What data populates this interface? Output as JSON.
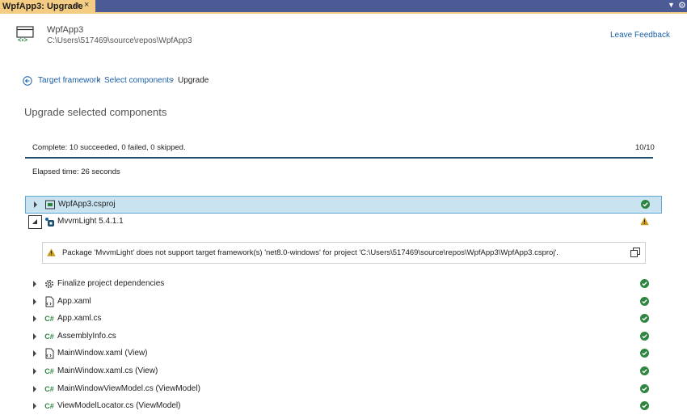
{
  "tab": {
    "title": "WpfApp3: Upgrade",
    "pin_glyph": "⊕",
    "close_glyph": "×",
    "dropdown_glyph": "▼",
    "gear_glyph": "⚙"
  },
  "header": {
    "project_name": "WpfApp3",
    "project_path": "C:\\Users\\517469\\source\\repos\\WpfApp3",
    "feedback_label": "Leave Feedback"
  },
  "breadcrumb": {
    "items": [
      "Target framework",
      "Select components",
      "Upgrade"
    ],
    "separator": "›"
  },
  "section_title": "Upgrade selected components",
  "progress": {
    "status_text": "Complete: 10 succeeded, 0 failed, 0 skipped.",
    "count_text": "10/10",
    "fraction": 1.0,
    "elapsed_text": "Elapsed time: 26 seconds"
  },
  "tree": {
    "items": [
      {
        "label": "WpfApp3.csproj",
        "icon": "project-icon",
        "status": "success",
        "selected": true
      },
      {
        "label": "MvvmLight 5.4.1.1",
        "icon": "package-icon",
        "status": "warning",
        "expanded": true
      },
      {
        "label": "Finalize project dependencies",
        "icon": "gear-icon",
        "status": "success"
      },
      {
        "label": "App.xaml",
        "icon": "xaml-file-icon",
        "status": "success"
      },
      {
        "label": "App.xaml.cs",
        "icon": "csharp-file-icon",
        "status": "success"
      },
      {
        "label": "AssemblyInfo.cs",
        "icon": "csharp-file-icon",
        "status": "success"
      },
      {
        "label": "MainWindow.xaml (View)",
        "icon": "xaml-file-icon",
        "status": "success"
      },
      {
        "label": "MainWindow.xaml.cs (View)",
        "icon": "csharp-file-icon",
        "status": "success"
      },
      {
        "label": "MainWindowViewModel.cs (ViewModel)",
        "icon": "csharp-file-icon",
        "status": "success"
      },
      {
        "label": "ViewModelLocator.cs (ViewModel)",
        "icon": "csharp-file-icon",
        "status": "success"
      }
    ],
    "warning_message": "Package 'MvvmLight' does not support target framework(s) 'net8.0-windows' for project 'C:\\Users\\517469\\source\\repos\\WpfApp3\\WpfApp3.csproj'.",
    "csharp_glyph": "C#"
  },
  "colors": {
    "accent": "#1a5fa8",
    "success": "#2e8540",
    "warning": "#c79a1a",
    "tab_active": "#f5cc84",
    "tab_bar": "#4c5b96"
  }
}
